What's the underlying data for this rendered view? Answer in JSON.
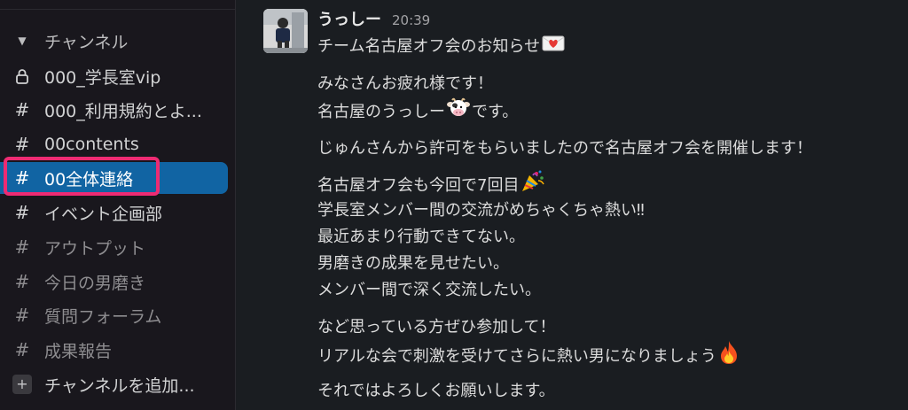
{
  "sidebar": {
    "section_label": "チャンネル",
    "channels": [
      {
        "prefix": "lock",
        "label": "000_学長室vip"
      },
      {
        "prefix": "#",
        "label": "000_利用規約とよ..."
      },
      {
        "prefix": "#",
        "label": "00contents"
      },
      {
        "prefix": "#",
        "label": "00全体連絡",
        "active": true
      },
      {
        "prefix": "#",
        "label": "イベント企画部"
      },
      {
        "prefix": "#",
        "label": "アウトプット"
      },
      {
        "prefix": "#",
        "label": "今日の男磨き"
      },
      {
        "prefix": "#",
        "label": "質問フォーラム"
      },
      {
        "prefix": "#",
        "label": "成果報告"
      }
    ],
    "add_channel_label": "チャンネルを追加..."
  },
  "message": {
    "author": "うっしー",
    "time": "20:39",
    "lines": [
      "チーム名古屋オフ会のお知らせ",
      "みなさんお疲れ様です！",
      "名古屋のうっしー",
      "です。",
      "じゅんさんから許可をもらいましたので名古屋オフ会を開催します！",
      "名古屋オフ会も今回で7回目",
      "学長室メンバー間の交流がめちゃくちゃ熱い‼",
      "最近あまり行動できてない。",
      "男磨きの成果を見せたい。",
      "メンバー間で深く交流したい。",
      "など思っている方ぜひ参加して！",
      "リアルな会で刺激を受けてさらに熱い男になりましょう",
      "それではよろしくお願いします。"
    ],
    "emojis": [
      "love-letter",
      "cow-face",
      "party-popper",
      "fire"
    ]
  },
  "colors": {
    "sidebar_bg": "#19171d",
    "main_bg": "#1a1d21",
    "active_channel": "#1164a3",
    "highlight_border": "#ee2b73"
  }
}
